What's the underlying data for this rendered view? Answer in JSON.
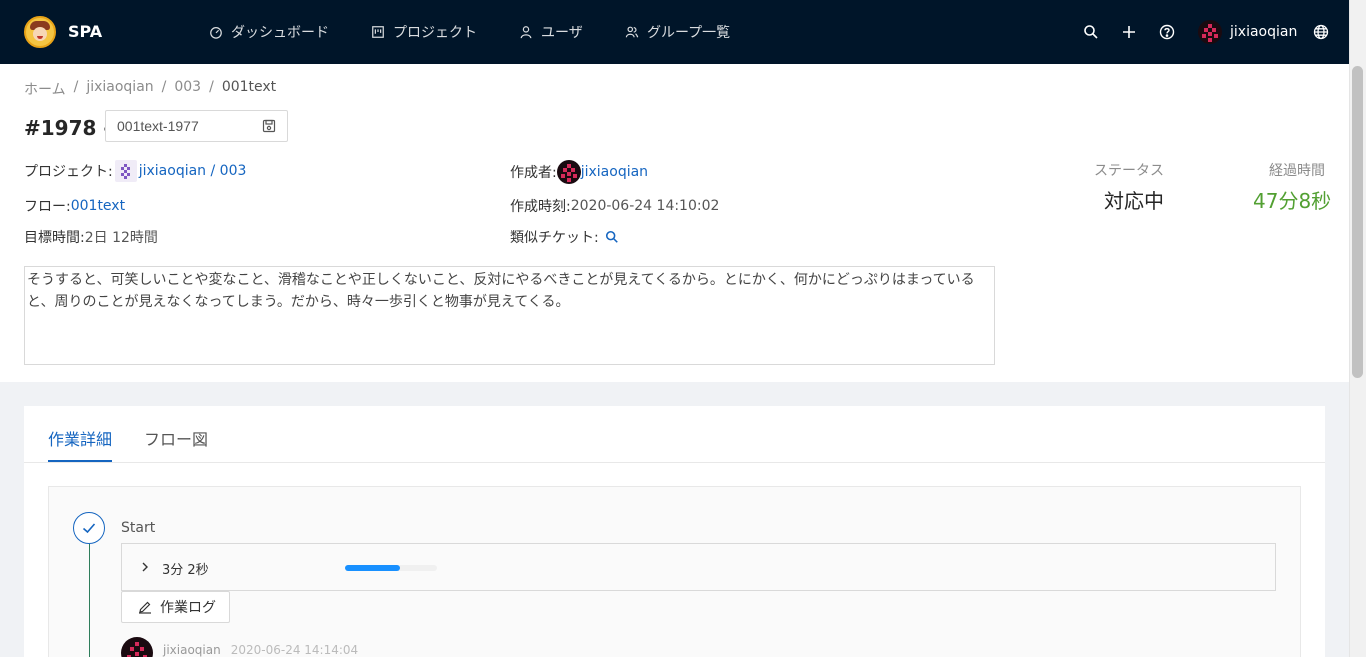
{
  "header": {
    "brand": "SPA",
    "nav": [
      {
        "label": "ダッシュボード",
        "icon": "dashboard-icon"
      },
      {
        "label": "プロジェクト",
        "icon": "project-icon"
      },
      {
        "label": "ユーザ",
        "icon": "user-icon"
      },
      {
        "label": "グループ一覧",
        "icon": "group-icon"
      }
    ],
    "icons": [
      "search-icon",
      "plus-icon",
      "help-icon",
      "globe-icon"
    ],
    "user": "jixiaoqian"
  },
  "breadcrumb": [
    "ホーム",
    "jixiaoqian",
    "003",
    "001text"
  ],
  "ticket": {
    "number": "#1978 -",
    "title_value": "001text-1977",
    "project_label": "プロジェクト:",
    "project_value": "jixiaoqian / 003",
    "flow_label": "フロー:",
    "flow_value": "001text",
    "target_label": "目標時間:",
    "target_value": "2日 12時間",
    "author_label": "作成者:",
    "author_value": "jixiaoqian",
    "created_label": "作成時刻:",
    "created_value": "2020-06-24 14:10:02",
    "similar_label": "類似チケット:",
    "status_label": "ステータス",
    "status_value": "対応中",
    "elapsed_label": "経過時間",
    "elapsed_value": "47分8秒",
    "description": "そうすると、可笑しいことや変なこと、滑稽なことや正しくないこと、反対にやるべきことが見えてくるから。とにかく、何かにどっぷりはまっていると、周りのことが見えなくなってしまう。だから、時々一歩引くと物事が見えてくる。"
  },
  "colors": {
    "header_bg": "#001529",
    "link": "#1565c0",
    "elapsed": "#52a032",
    "progress": "#1890ff"
  },
  "tabs": [
    {
      "label": "作業詳細",
      "active": true
    },
    {
      "label": "フロー図",
      "active": false
    }
  ],
  "workflow": {
    "step_title": "Start",
    "duration": "3分 2秒",
    "progress_percent": 60,
    "log_button": "作業ログ",
    "log_user": "jixiaoqian",
    "log_time": "2020-06-24 14:14:04"
  }
}
